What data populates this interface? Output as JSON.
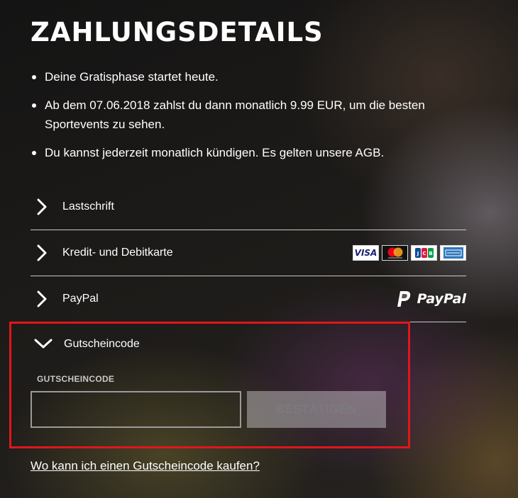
{
  "title": "ZAHLUNGSDETAILS",
  "info": [
    "Deine Gratisphase startet heute.",
    "Ab dem 07.06.2018 zahlst du dann monatlich 9.99 EUR, um die besten Sportevents zu sehen.",
    "Du kannst jederzeit monatlich kündigen. Es gelten unsere AGB."
  ],
  "payment_methods": [
    {
      "label": "Lastschrift",
      "state": "collapsed",
      "icon": "chevron-right-icon"
    },
    {
      "label": "Kredit- und Debitkarte",
      "state": "collapsed",
      "icon": "chevron-right-icon",
      "card_logos": [
        "VISA",
        "mastercard",
        "JCB",
        "American Express"
      ]
    },
    {
      "label": "PayPal",
      "state": "collapsed",
      "icon": "chevron-right-icon",
      "logo_text": "PayPal"
    }
  ],
  "voucher": {
    "label": "Gutscheincode",
    "state": "expanded",
    "icon": "chevron-down-icon",
    "field_label": "GUTSCHEINCODE",
    "input_value": "",
    "input_placeholder": "",
    "confirm_label": "BESTÄTIGEN",
    "highlight_color": "#e0161b"
  },
  "buy_link": "Wo kann ich einen Gutscheincode kaufen?",
  "colors": {
    "paypal_blue": "#1a1f71",
    "mastercard_red": "#eb001b",
    "mastercard_orange": "#f79e1b",
    "amex_blue": "#2e77bc"
  }
}
